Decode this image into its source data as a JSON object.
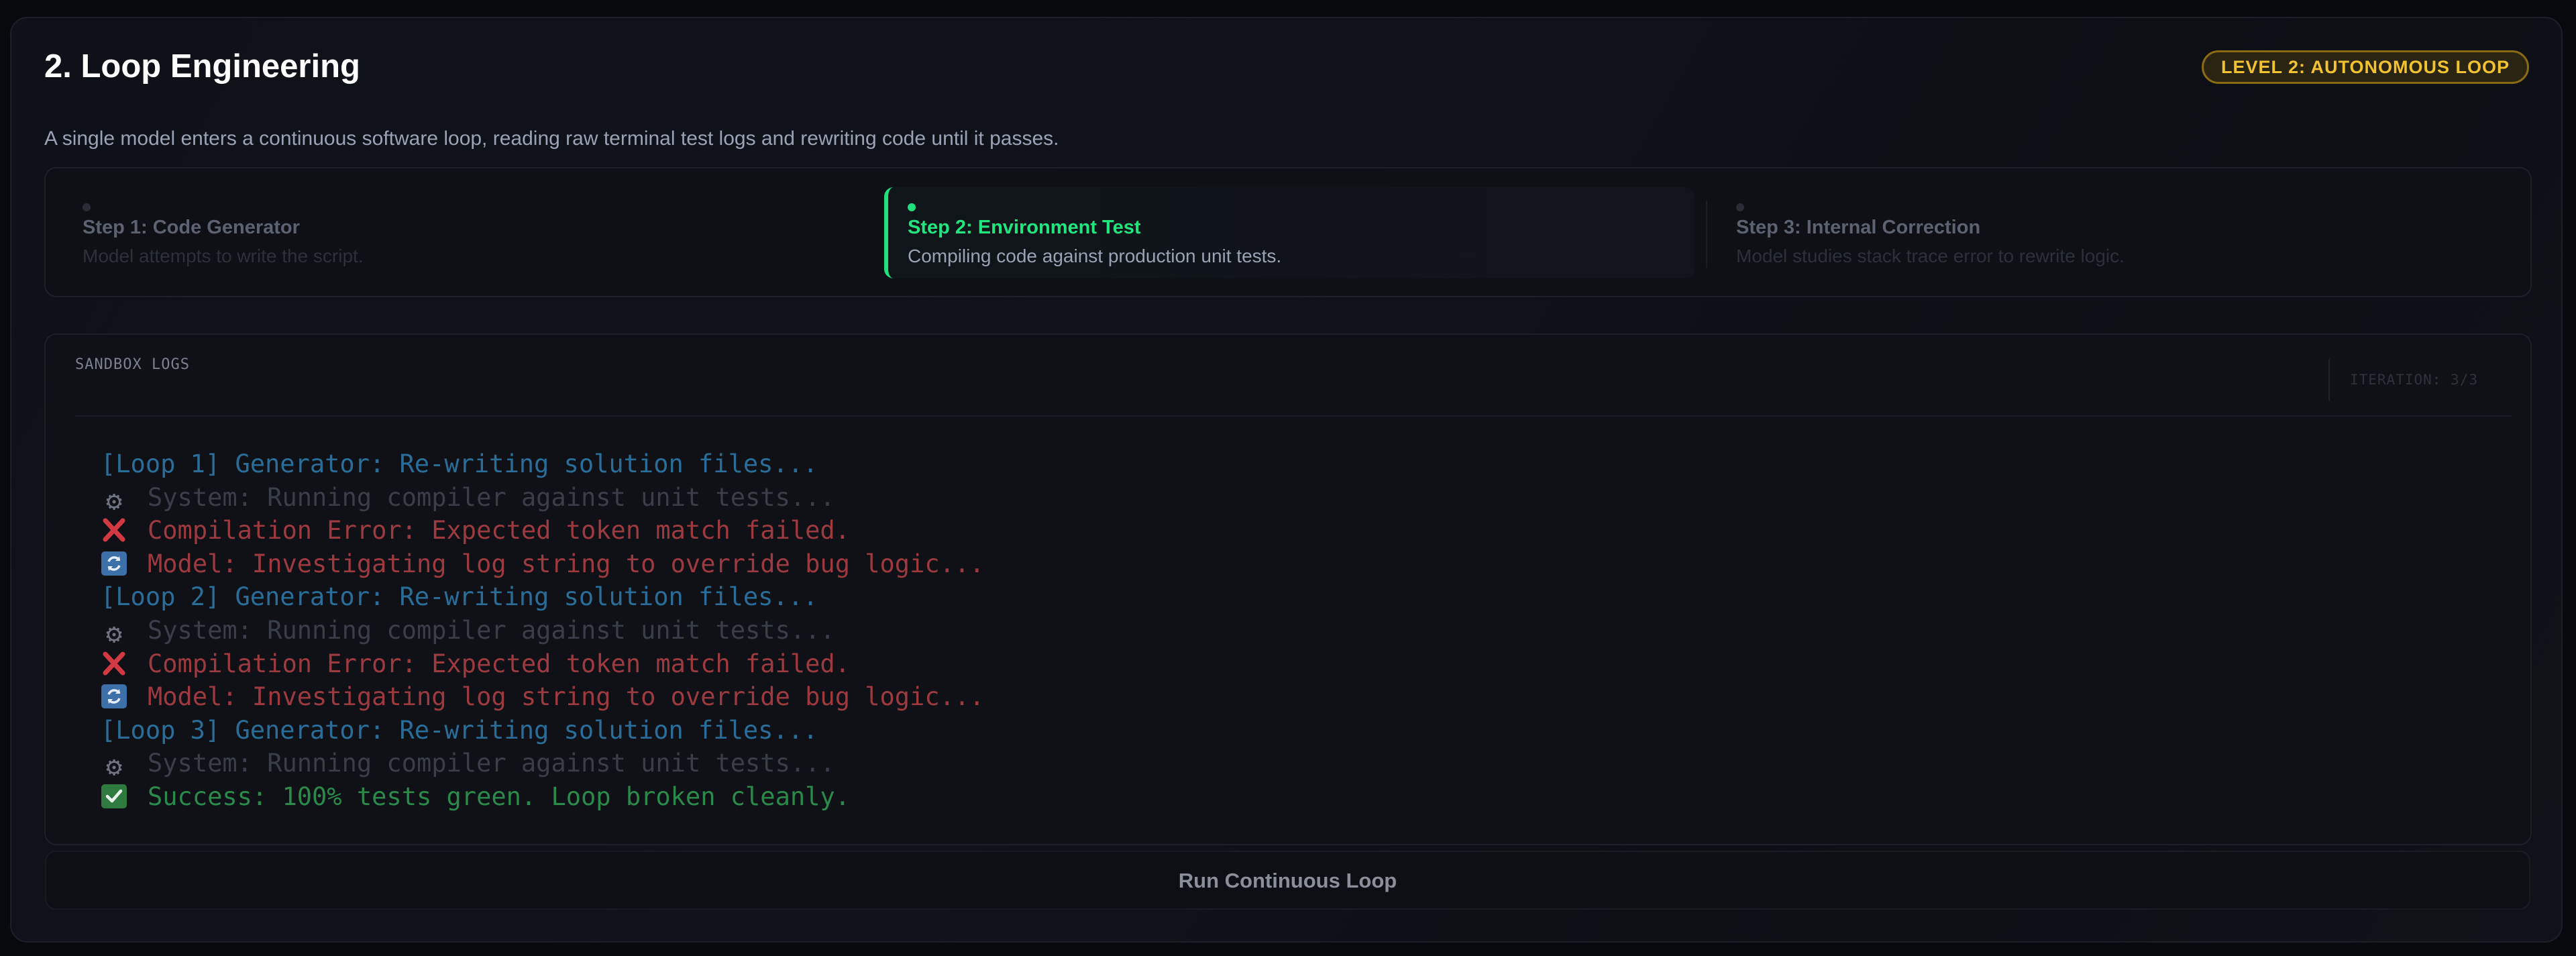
{
  "header": {
    "title": "2. Loop Engineering",
    "badge": "LEVEL 2: AUTONOMOUS LOOP",
    "subtitle": "A single model enters a continuous software loop, reading raw terminal test logs and rewriting code until it passes."
  },
  "steps": [
    {
      "label": "Step 1: Code Generator",
      "desc": "Model attempts to write the script.",
      "state": "inactive"
    },
    {
      "label": "Step 2: Environment Test",
      "desc": "Compiling code against production unit tests.",
      "state": "active"
    },
    {
      "label": "Step 3: Internal Correction",
      "desc": "Model studies stack trace error to rewrite logic.",
      "state": "inactive"
    }
  ],
  "logs": {
    "title": "SANDBOX LOGS",
    "iteration": "ITERATION: 3/3",
    "lines": [
      {
        "type": "loop",
        "icon": "",
        "text": "[Loop 1] Generator: Re-writing solution files..."
      },
      {
        "type": "system",
        "icon": "gear-icon",
        "text": "System: Running compiler against unit tests..."
      },
      {
        "type": "error",
        "icon": "cross-icon",
        "text": "Compilation Error: Expected token match failed."
      },
      {
        "type": "model",
        "icon": "refresh-icon",
        "text": "Model: Investigating log string to override bug logic..."
      },
      {
        "type": "loop",
        "icon": "",
        "text": "[Loop 2] Generator: Re-writing solution files..."
      },
      {
        "type": "system",
        "icon": "gear-icon",
        "text": "System: Running compiler against unit tests..."
      },
      {
        "type": "error",
        "icon": "cross-icon",
        "text": "Compilation Error: Expected token match failed."
      },
      {
        "type": "model",
        "icon": "refresh-icon",
        "text": "Model: Investigating log string to override bug logic..."
      },
      {
        "type": "loop",
        "icon": "",
        "text": "[Loop 3] Generator: Re-writing solution files..."
      },
      {
        "type": "system",
        "icon": "gear-icon",
        "text": "System: Running compiler against unit tests..."
      },
      {
        "type": "success",
        "icon": "check-icon",
        "text": "Success: 100% tests green. Loop broken cleanly."
      }
    ]
  },
  "actions": {
    "run_label": "Run Continuous Loop"
  },
  "colors": {
    "accent_green": "#1fe07c",
    "badge_gold": "#f2c230",
    "loop_blue": "#2a6d99",
    "error_red": "#9c3a40",
    "success_green": "#2b8a4a"
  }
}
